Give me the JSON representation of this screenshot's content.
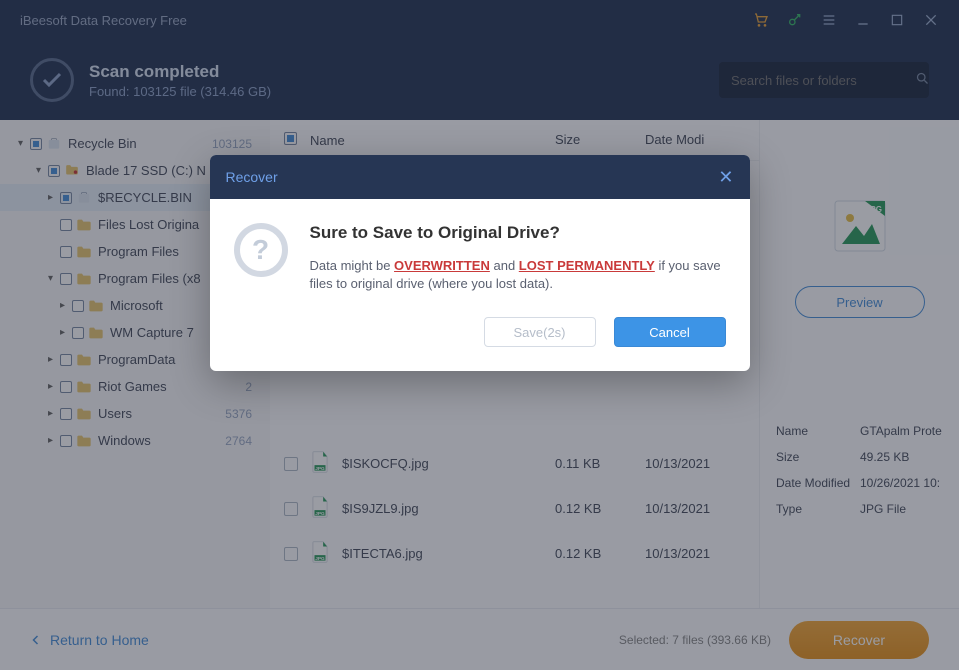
{
  "app": {
    "title": "iBeesoft Data Recovery Free"
  },
  "header": {
    "scan_title": "Scan completed",
    "scan_sub": "Found: 103125 file (314.46 GB)",
    "search_placeholder": "Search files or folders"
  },
  "tree": [
    {
      "indent": 0,
      "chev": "▾",
      "mixed": true,
      "icon": "recycle",
      "label": "Recycle Bin",
      "count": "103125"
    },
    {
      "indent": 1,
      "chev": "▾",
      "mixed": true,
      "icon": "drive",
      "label": "Blade 17 SSD (C:) N",
      "count": ""
    },
    {
      "indent": 2,
      "chev": "▸",
      "mixed": true,
      "icon": "recycle-s",
      "label": "$RECYCLE.BIN",
      "count": "",
      "selected": true
    },
    {
      "indent": 2,
      "chev": "",
      "mixed": false,
      "icon": "folder",
      "label": "Files Lost Origina",
      "count": ""
    },
    {
      "indent": 2,
      "chev": "",
      "mixed": false,
      "icon": "folder",
      "label": "Program Files",
      "count": ""
    },
    {
      "indent": 2,
      "chev": "▾",
      "mixed": false,
      "icon": "folder",
      "label": "Program Files (x8",
      "count": ""
    },
    {
      "indent": 3,
      "chev": "▸",
      "mixed": false,
      "icon": "folder",
      "label": "Microsoft",
      "count": ""
    },
    {
      "indent": 3,
      "chev": "▸",
      "mixed": false,
      "icon": "folder",
      "label": "WM Capture 7",
      "count": ""
    },
    {
      "indent": 2,
      "chev": "▸",
      "mixed": false,
      "icon": "folder",
      "label": "ProgramData",
      "count": ""
    },
    {
      "indent": 2,
      "chev": "▸",
      "mixed": false,
      "icon": "folder",
      "label": "Riot Games",
      "count": "2"
    },
    {
      "indent": 2,
      "chev": "▸",
      "mixed": false,
      "icon": "folder",
      "label": "Users",
      "count": "5376"
    },
    {
      "indent": 2,
      "chev": "▸",
      "mixed": false,
      "icon": "folder",
      "label": "Windows",
      "count": "2764"
    }
  ],
  "list": {
    "cols": {
      "name": "Name",
      "size": "Size",
      "date": "Date Modi"
    },
    "rows": [
      {
        "name": "$ISKOCFQ.jpg",
        "size": "0.11 KB",
        "date": "10/13/2021"
      },
      {
        "name": "$IS9JZL9.jpg",
        "size": "0.12 KB",
        "date": "10/13/2021"
      },
      {
        "name": "$ITECTA6.jpg",
        "size": "0.12 KB",
        "date": "10/13/2021"
      }
    ]
  },
  "preview": {
    "badge": "JPG",
    "btn": "Preview",
    "rows": [
      {
        "label": "Name",
        "value": "GTApalm Prote"
      },
      {
        "label": "Size",
        "value": "49.25 KB"
      },
      {
        "label": "Date Modified",
        "value": "10/26/2021 10:"
      },
      {
        "label": "Type",
        "value": "JPG File"
      }
    ]
  },
  "footer": {
    "back": "Return to Home",
    "selected": "Selected: 7 files (393.66 KB)",
    "recover": "Recover"
  },
  "dialog": {
    "title": "Recover",
    "heading": "Sure to Save to Original Drive?",
    "msg_pre": "Data might be ",
    "msg_warn1": "OVERWRITTEN",
    "msg_mid": " and ",
    "msg_warn2": "LOST PERMANENTLY",
    "msg_post": " if you save files to original drive (where you lost data).",
    "save": "Save(2s)",
    "cancel": "Cancel"
  }
}
